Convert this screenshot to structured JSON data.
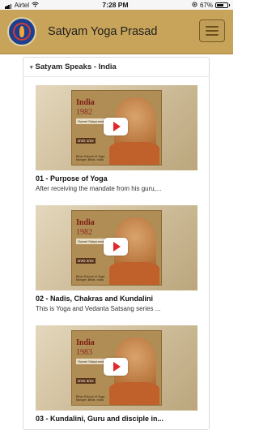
{
  "status_bar": {
    "carrier": "Airtel",
    "time": "7:28 PM",
    "battery": "67%"
  },
  "header": {
    "title": "Satyam Yoga Prasad"
  },
  "section": {
    "title": "Satyam Speaks - India"
  },
  "items": [
    {
      "title": "01 - Purpose of Yoga",
      "description": "After receiving the mandate from his guru,...",
      "cover_title": "India",
      "cover_year": "1982",
      "cover_subtitle": "Swami Satyananda Saraswati",
      "cover_dvd": "DVD 1/10",
      "cover_publisher": "Bihar School of Yoga Munger, Bihar, India"
    },
    {
      "title": "02 - Nadis, Chakras and Kundalini",
      "description": "This is Yoga and Vedanta Satsang series ...",
      "cover_title": "India",
      "cover_year": "1982",
      "cover_subtitle": "Swami Satyananda Saraswati",
      "cover_dvd": "DVD 2/10",
      "cover_publisher": "Bihar School of Yoga Munger, Bihar, India"
    },
    {
      "title": "03 - Kundalini, Guru and disciple in...",
      "description": "",
      "cover_title": "India",
      "cover_year": "1983",
      "cover_subtitle": "Swami Satyananda Saraswati",
      "cover_dvd": "DVD 3/10",
      "cover_publisher": "Bihar School of Yoga Munger, Bihar, India"
    }
  ],
  "colors": {
    "header_bg": "#c8a45a",
    "play_red": "#e02a2a"
  },
  "icons": {
    "menu": "hamburger-menu-icon",
    "play": "play-icon",
    "logo": "satyam-logo"
  }
}
